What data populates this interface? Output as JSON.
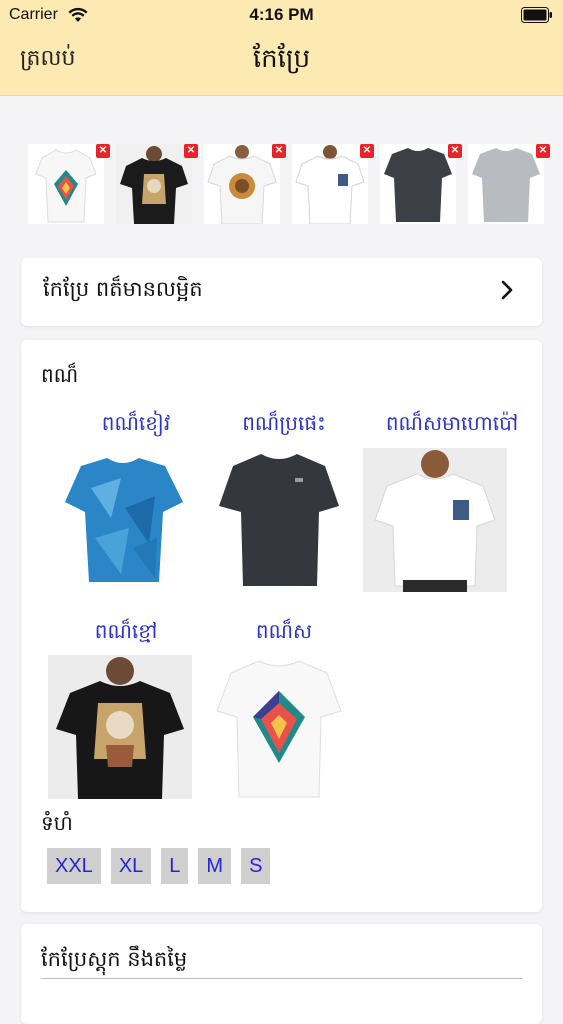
{
  "status_bar": {
    "carrier": "Carrier",
    "time": "4:16 PM"
  },
  "nav": {
    "back_label": "ត្រលប់",
    "title": "កែប្រែ"
  },
  "thumbnails": [
    {
      "name": "white-geometric-tee",
      "shirt_color": "#ffffff"
    },
    {
      "name": "black-graphic-tee",
      "shirt_color": "#1b1b1b"
    },
    {
      "name": "white-lion-tee",
      "shirt_color": "#ffffff"
    },
    {
      "name": "white-pocket-tee",
      "shirt_color": "#ffffff"
    },
    {
      "name": "dark-gray-tee",
      "shirt_color": "#3d3f46"
    },
    {
      "name": "light-gray-tee",
      "shirt_color": "#b8bcc0"
    }
  ],
  "edit_details": {
    "label": "កែប្រែ ពត៏មានលម្អិត"
  },
  "colors": {
    "heading": "ពណ៏",
    "items": [
      {
        "label": "ពណ៏ខៀវ",
        "shirt_color": "#2a86c6"
      },
      {
        "label": "ពណ៏ប្រផេះ",
        "shirt_color": "#35373e"
      },
      {
        "label": "ពណ៏សមាហោប៉ៅ",
        "shirt_color": "#ffffff"
      },
      {
        "label": "ពណ៏ខ្មៅ",
        "shirt_color": "#171717"
      },
      {
        "label": "ពណ៏ស",
        "shirt_color": "#ffffff"
      }
    ]
  },
  "sizes": {
    "heading": "ទំហំ",
    "options": [
      "XXL",
      "XL",
      "L",
      "M",
      "S"
    ]
  },
  "stock": {
    "label": "កែប្រែស្តុក នឹងតម្លៃ"
  }
}
